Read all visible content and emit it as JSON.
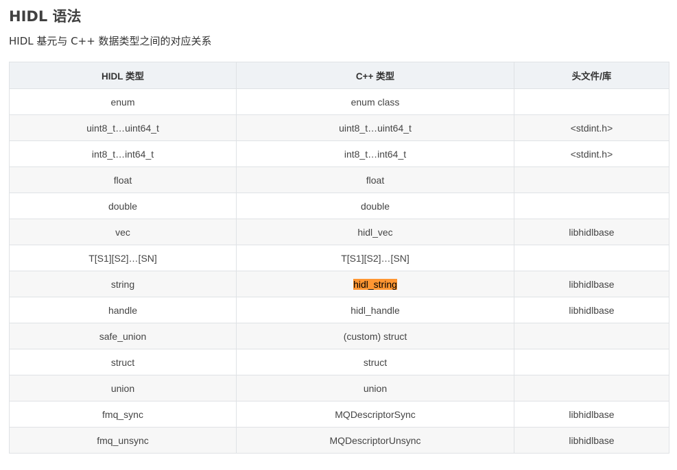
{
  "page": {
    "title": "HIDL 语法",
    "subtitle": "HIDL 基元与 C++ 数据类型之间的对应关系"
  },
  "colors": {
    "highlight": "#ff9632",
    "header_bg": "#eff2f5",
    "border": "#dfe2e5"
  },
  "table": {
    "headers": {
      "hidl": "HIDL 类型",
      "cpp": "C++ 类型",
      "lib": "头文件/库"
    },
    "rows": [
      {
        "hidl": "enum",
        "cpp": "enum class",
        "lib": ""
      },
      {
        "hidl": "uint8_t…uint64_t",
        "cpp": "uint8_t…uint64_t",
        "lib": "<stdint.h>"
      },
      {
        "hidl": "int8_t…int64_t",
        "cpp": "int8_t…int64_t",
        "lib": "<stdint.h>"
      },
      {
        "hidl": "float",
        "cpp": "float",
        "lib": ""
      },
      {
        "hidl": "double",
        "cpp": "double",
        "lib": ""
      },
      {
        "hidl": "vec",
        "cpp": "hidl_vec",
        "lib": "libhidlbase"
      },
      {
        "hidl": "T[S1][S2]…[SN]",
        "cpp": "T[S1][S2]…[SN]",
        "lib": ""
      },
      {
        "hidl": "string",
        "cpp": "hidl_string",
        "lib": "libhidlbase",
        "highlight_cpp": true
      },
      {
        "hidl": "handle",
        "cpp": "hidl_handle",
        "lib": "libhidlbase"
      },
      {
        "hidl": "safe_union",
        "cpp": "(custom) struct",
        "lib": ""
      },
      {
        "hidl": "struct",
        "cpp": "struct",
        "lib": ""
      },
      {
        "hidl": "union",
        "cpp": "union",
        "lib": ""
      },
      {
        "hidl": "fmq_sync",
        "cpp": "MQDescriptorSync",
        "lib": "libhidlbase"
      },
      {
        "hidl": "fmq_unsync",
        "cpp": "MQDescriptorUnsync",
        "lib": "libhidlbase"
      }
    ]
  }
}
